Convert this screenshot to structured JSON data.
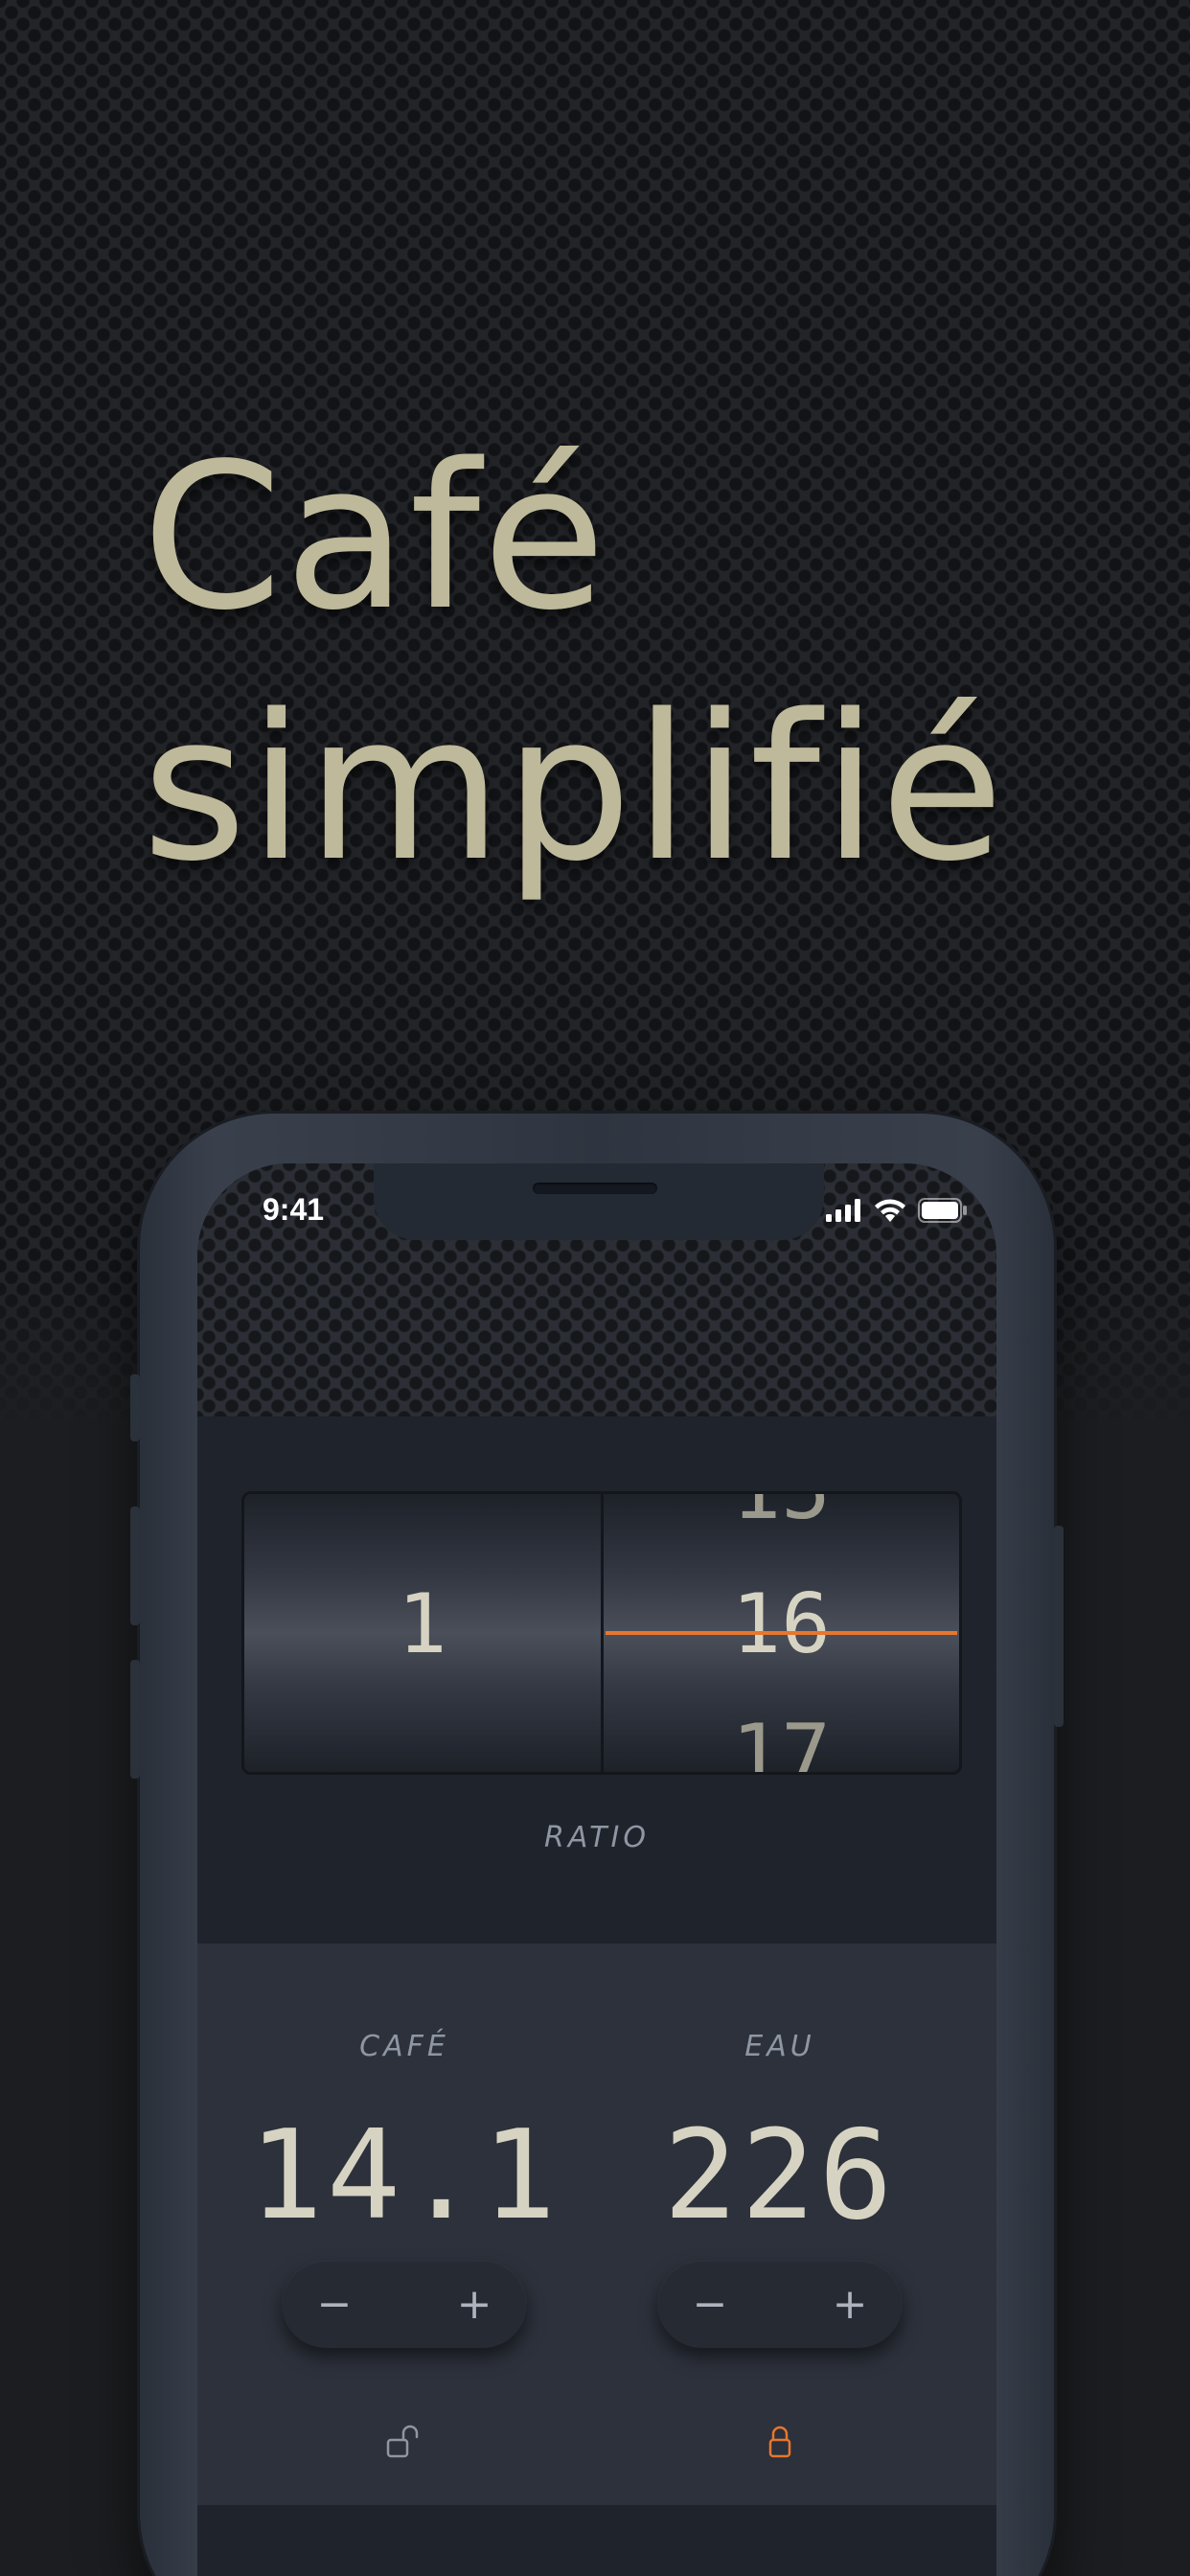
{
  "headline": {
    "line1": "Café",
    "line2": "simplifié"
  },
  "status_bar": {
    "time": "9:41"
  },
  "ratio": {
    "label": "RATIO",
    "left_value": "1",
    "right_prev": "15",
    "right_value": "16",
    "right_next": "17"
  },
  "coffee": {
    "label": "CAFÉ",
    "value": "14.1",
    "minus": "−",
    "plus": "+",
    "locked": false
  },
  "water": {
    "label": "EAU",
    "value": "226",
    "minus": "−",
    "plus": "+",
    "locked": true
  },
  "colors": {
    "accent": "#e8762e",
    "headline": "#bdb99a",
    "digits": "#d6d3c2",
    "label": "#8f96a3"
  },
  "icons": [
    "signal-icon",
    "wifi-icon",
    "battery-icon",
    "unlock-icon",
    "lock-icon"
  ]
}
